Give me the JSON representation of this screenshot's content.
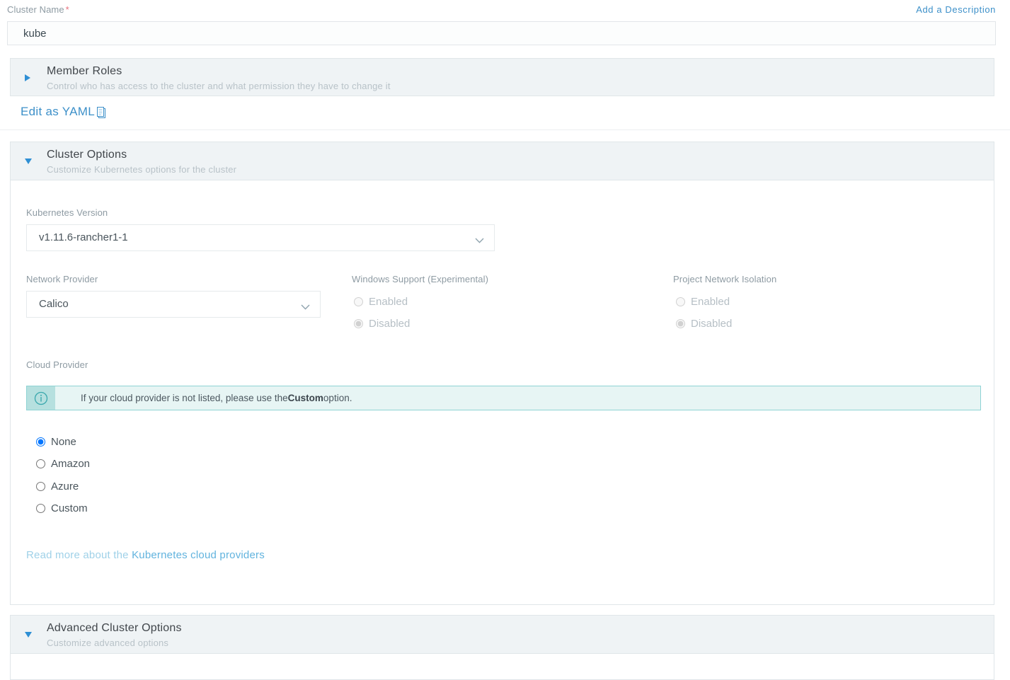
{
  "cluster_name_field": {
    "label": "Cluster Name",
    "required_marker": "*",
    "value": "kube",
    "placeholder": ""
  },
  "add_description_link": "Add a Description",
  "member_roles_panel": {
    "title": "Member Roles",
    "subtitle": "Control who has access to the cluster and what permission they have to change it",
    "expanded": false,
    "caret_icon": "triangle-right-icon"
  },
  "edit_as_yaml": {
    "label": "Edit as YAML",
    "icon": "clipboard-icon"
  },
  "cluster_options_panel": {
    "title": "Cluster Options",
    "subtitle": "Customize Kubernetes options for the cluster",
    "expanded": true,
    "caret_icon": "triangle-down-icon"
  },
  "kubernetes_version": {
    "label": "Kubernetes Version",
    "value": "v1.11.6-rancher1-1",
    "caret_icon": "chevron-down-icon"
  },
  "network_provider": {
    "label": "Network Provider",
    "value": "Calico",
    "caret_icon": "chevron-down-icon"
  },
  "windows_support": {
    "label": "Windows Support (Experimental)",
    "options": [
      {
        "label": "Enabled",
        "selected": false,
        "disabled": true
      },
      {
        "label": "Disabled",
        "selected": true,
        "disabled": true
      }
    ]
  },
  "project_network_isolation": {
    "label": "Project Network Isolation",
    "options": [
      {
        "label": "Enabled",
        "selected": false,
        "disabled": true
      },
      {
        "label": "Disabled",
        "selected": true,
        "disabled": true
      }
    ]
  },
  "cloud_provider": {
    "label": "Cloud Provider",
    "banner": {
      "icon": "info-circle-icon",
      "text_before": "If your cloud provider is not listed, please use the ",
      "text_bold": "Custom",
      "text_after": " option."
    },
    "options": [
      {
        "label": "None",
        "selected": true
      },
      {
        "label": "Amazon",
        "selected": false
      },
      {
        "label": "Azure",
        "selected": false
      },
      {
        "label": "Custom",
        "selected": false
      }
    ],
    "read_more_prefix": "Read more about the ",
    "read_more_link": "Kubernetes cloud providers"
  },
  "advanced_cluster_options_panel": {
    "title": "Advanced Cluster Options",
    "subtitle": "Customize advanced options",
    "expanded": true,
    "caret_icon": "triangle-down-icon"
  },
  "colors": {
    "link_blue": "#3d90c9",
    "caret_blue": "#2f8fd4",
    "panel_head_bg": "#eff3f5",
    "panel_border": "#e0e6e9",
    "required_red": "#e8717d",
    "info_banner_bg": "#e7f5f4",
    "info_banner_border": "#8fd3d4",
    "info_icon_bg": "#b6e0df",
    "info_icon_teal": "#3aa8ad",
    "muted_label": "#8e9ba3"
  }
}
